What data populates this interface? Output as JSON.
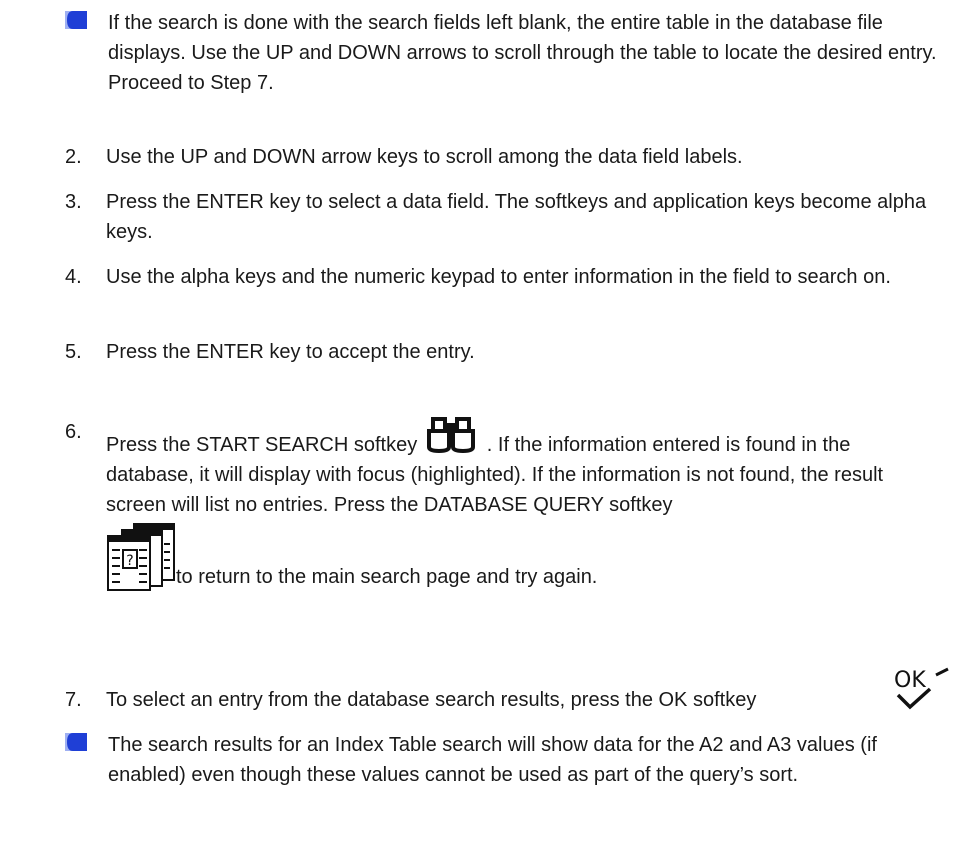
{
  "notes": [
    {
      "icon": "note-bullet-icon",
      "text": "If the search is done with the search fields left blank, the entire table in the database file displays. Use the UP and DOWN arrows to scroll through the table to locate the desired entry. Proceed to Step 7."
    },
    {
      "icon": "note-bullet-icon",
      "text": "The search results for an Index Table search will show data for the A2 and A3 values (if enabled) even though these values cannot be used as part of the query’s sort."
    }
  ],
  "steps": [
    {
      "num": "2.",
      "text": "Use the UP and DOWN arrow keys to scroll among the data field labels."
    },
    {
      "num": "3.",
      "text": "Press the ENTER key to select a data field. The softkeys and application keys become alpha keys."
    },
    {
      "num": "4.",
      "text": "Use the alpha keys and the numeric keypad to enter information in the field to search on."
    },
    {
      "num": "5.",
      "text": "Press the ENTER key to accept the entry."
    },
    {
      "num": "6.",
      "text_before_icon": "Press the START SEARCH softkey",
      "icon": "binoculars-icon",
      "text_after_icon": ". If the information entered is found in the database, it will display with focus (highlighted). If the information is not found, the result screen will list no entries. Press the DATABASE QUERY softkey",
      "icon2": "database-query-icon",
      "text_tail": "to return to the main search page and try again."
    },
    {
      "num": "7.",
      "text": "To select an entry from the database search results, press the OK softkey",
      "icon": "ok-check-icon",
      "icon_label": "OK"
    }
  ],
  "colors": {
    "text": "#1a1a1a",
    "bullet_blue": "#1f3fd6",
    "bullet_light": "#9fb0f2"
  }
}
